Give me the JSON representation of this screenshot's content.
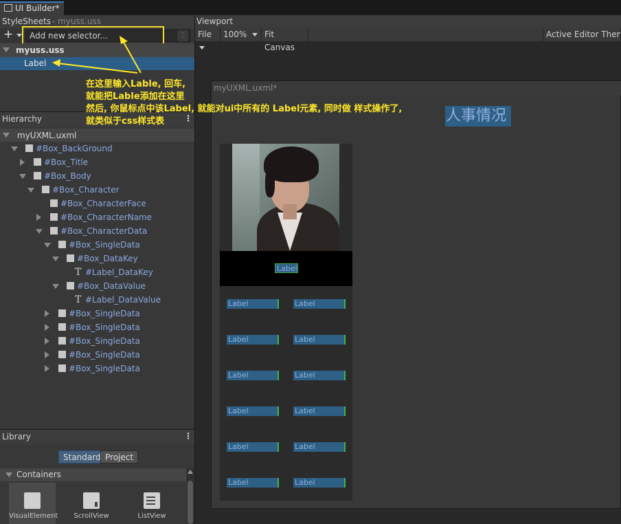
{
  "window": {
    "tab_title": "UI Builder*"
  },
  "stylesheets": {
    "title": "StyleSheets",
    "file": "- myuss.uss",
    "add_button": "+",
    "selector_placeholder": "Add new selector...",
    "options_glyph": "⋮",
    "sheet_name": "myuss.uss",
    "selectors": [
      "Label"
    ]
  },
  "hierarchy": {
    "title": "Hierarchy",
    "menu_glyph": "⋮",
    "root": "myUXML.uxml",
    "items": [
      {
        "label": "#Box_BackGround"
      },
      {
        "label": "#Box_Title"
      },
      {
        "label": "#Box_Body"
      },
      {
        "label": "#Box_Character"
      },
      {
        "label": "#Box_CharacterFace"
      },
      {
        "label": "#Box_CharacterName"
      },
      {
        "label": "#Box_CharacterData"
      },
      {
        "label": "#Box_SingleData"
      },
      {
        "label": "#Box_DataKey"
      },
      {
        "label": "#Label_DataKey"
      },
      {
        "label": "#Box_DataValue"
      },
      {
        "label": "#Label_DataValue"
      },
      {
        "label": "#Box_SingleData"
      },
      {
        "label": "#Box_SingleData"
      },
      {
        "label": "#Box_SingleData"
      },
      {
        "label": "#Box_SingleData"
      },
      {
        "label": "#Box_SingleData"
      }
    ]
  },
  "library": {
    "title": "Library",
    "menu_glyph": "⋮",
    "tabs": [
      "Standard",
      "Project"
    ],
    "section": "Containers",
    "tiles": [
      "VisualElement",
      "ScrollView",
      "ListView"
    ]
  },
  "viewport": {
    "title": "Viewport",
    "file_menu": "File",
    "zoom": "100%",
    "fit_canvas": "Fit Canvas",
    "theme": "Active Editor Theme",
    "canvas_title": "myUXML.uxml*",
    "page_title": "人事情况",
    "name_label": "Label",
    "data_label": "Label"
  },
  "annotation": {
    "line1": "在这里输入Lable, 回车,",
    "line2": "就能把Lable添加在这里",
    "line3": "然后, 你鼠标点中该Label, 就能对ui中所有的 Label元素, 同时做 样式操作了,",
    "line4": "就类似于css样式表"
  },
  "colors": {
    "accent": "#3a79bb",
    "selection": "#2c5d87",
    "annotation": "#ffe82a",
    "label_bg": "#2e5f85"
  }
}
